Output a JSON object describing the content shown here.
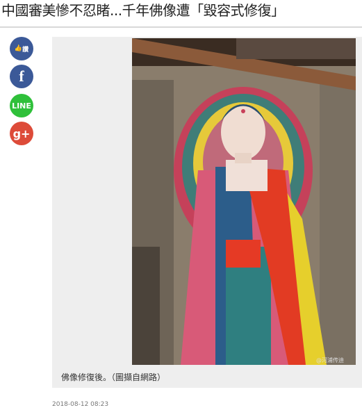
{
  "article": {
    "title": "中國審美慘不忍睹...千年佛像遭「毀容式修復」",
    "caption": "佛像修復後。（圖擷自網路）",
    "date": "2018-08-12 08:23",
    "watermark": "@河浦传迪"
  },
  "share": {
    "like_label": "讚",
    "facebook_label": "f",
    "line_label": "LINE",
    "gplus_label": "g+"
  },
  "colors": {
    "facebook": "#3b5998",
    "line": "#2fc03a",
    "gplus": "#dd4b39",
    "figure_bg": "#eeeeee"
  }
}
